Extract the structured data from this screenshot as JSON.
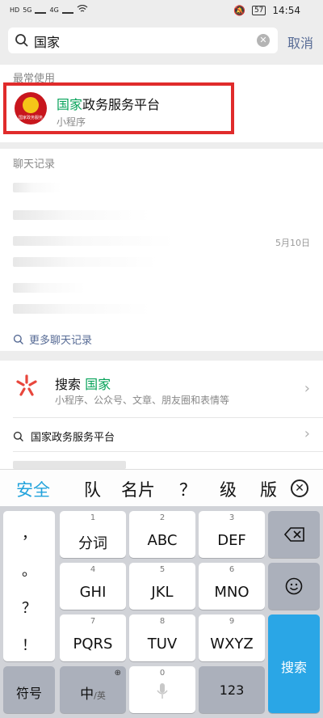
{
  "status_bar": {
    "left_tags": [
      "HD",
      "5G",
      "4G"
    ],
    "battery": "57",
    "time": "14:54"
  },
  "search": {
    "query": "国家",
    "cancel_label": "取消"
  },
  "frequent": {
    "section_title": "最常使用",
    "app": {
      "name_highlight": "国家",
      "name_rest": "政务服务平台",
      "type": "小程序",
      "logo_text": "国家政务服务"
    }
  },
  "chat_records": {
    "section_title": "聊天记录",
    "date": "5月10日",
    "more_label": "更多聊天记录"
  },
  "search_suggest": {
    "title_prefix": "搜索",
    "title_keyword": "国家",
    "subtitle": "小程序、公众号、文章、朋友圈和表情等",
    "suggestion": "国家政务服务平台"
  },
  "candidates": [
    "安全",
    "队",
    "名片",
    "？",
    "级",
    "版"
  ],
  "keyboard": {
    "punctuation": [
      "，",
      "。",
      "？",
      "！"
    ],
    "rows": [
      [
        {
          "num": "1",
          "label": "分词"
        },
        {
          "num": "2",
          "label": "ABC"
        },
        {
          "num": "3",
          "label": "DEF"
        }
      ],
      [
        {
          "num": "4",
          "label": "GHI"
        },
        {
          "num": "5",
          "label": "JKL"
        },
        {
          "num": "6",
          "label": "MNO"
        }
      ],
      [
        {
          "num": "7",
          "label": "PQRS"
        },
        {
          "num": "8",
          "label": "TUV"
        },
        {
          "num": "9",
          "label": "WXYZ"
        }
      ]
    ],
    "symbol_label": "符号",
    "lang_label": "中",
    "lang_sub": "/英",
    "space_num": "0",
    "num_label": "123",
    "search_label": "搜索"
  },
  "colors": {
    "highlight": "#07a35a",
    "link": "#576b95",
    "accent": "#2aa6e6",
    "annotation_box": "#e02b2b"
  }
}
